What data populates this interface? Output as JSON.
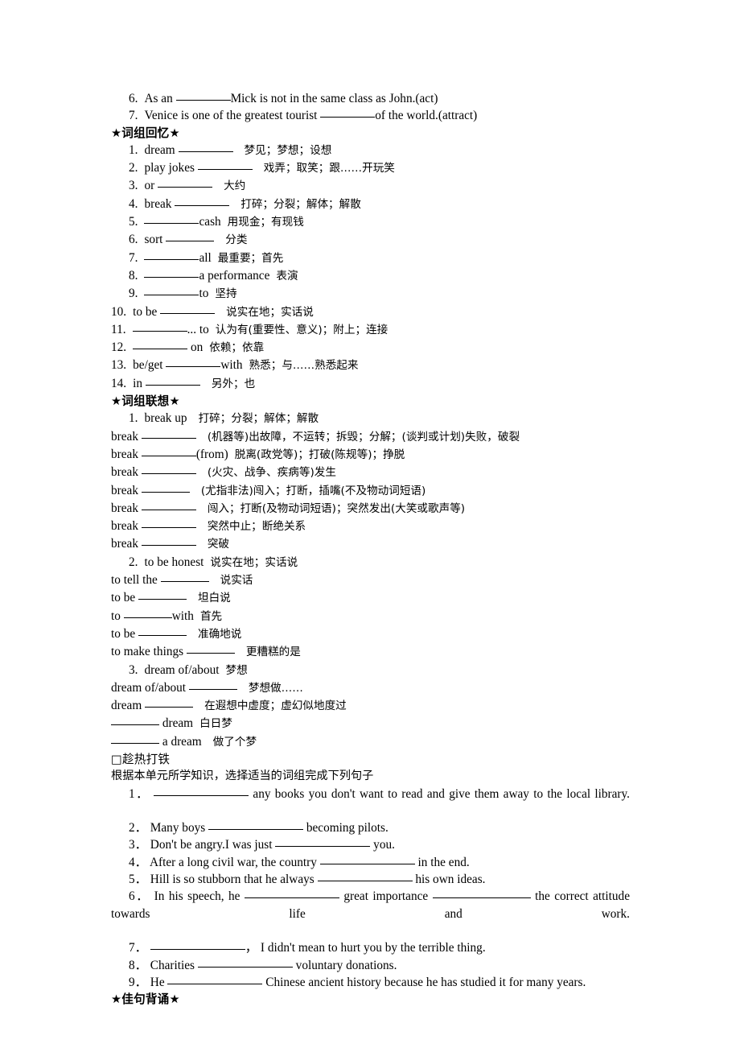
{
  "document": {
    "type": "english-workbook-worksheet",
    "language": "en-zh"
  },
  "word_form_items": [
    {
      "number": "6.",
      "before": "As an",
      "after": "Mick is not in the same class as John.(act)"
    },
    {
      "number": "7.",
      "before": "Venice is one of the greatest tourist",
      "after": "of the world.(attract)"
    }
  ],
  "phrase_recall": {
    "heading": "★词组回忆★",
    "items": [
      {
        "number": "1.",
        "before": "dream",
        "after": "",
        "gloss": "梦见；梦想；设想"
      },
      {
        "number": "2.",
        "before": "play jokes",
        "after": "",
        "gloss": "戏弄；取笑；跟……开玩笑"
      },
      {
        "number": "3.",
        "before": "or",
        "after": "",
        "gloss": "大约"
      },
      {
        "number": "4.",
        "before": "break",
        "after": "",
        "gloss": "打碎；分裂；解体；解散"
      },
      {
        "number": "5.",
        "before": "",
        "after": "cash",
        "gloss": "用现金；有现钱"
      },
      {
        "number": "6.",
        "before": "sort",
        "after": "",
        "gloss": "分类"
      },
      {
        "number": "7.",
        "before": "",
        "after": "all",
        "gloss": "最重要；首先"
      },
      {
        "number": "8.",
        "before": "",
        "after": "a performance",
        "gloss": "表演"
      },
      {
        "number": "9.",
        "before": "",
        "after": "to",
        "gloss": "坚持"
      },
      {
        "number": "10.",
        "before": "to be",
        "after": "",
        "gloss": "说实在地；实话说"
      },
      {
        "number": "11.",
        "before": "",
        "after": "... to",
        "gloss": "认为有(重要性、意义)；附上；连接"
      },
      {
        "number": "12.",
        "before": "",
        "after": "on",
        "gloss": "依赖；依靠"
      },
      {
        "number": "13.",
        "before": "be/get",
        "after": "with",
        "gloss": "熟悉；与……熟悉起来"
      },
      {
        "number": "14.",
        "before": "in",
        "after": "",
        "gloss": "另外；也"
      }
    ]
  },
  "phrase_association": {
    "heading": "★词组联想★",
    "groups": [
      {
        "number": "1.",
        "headword": "break up",
        "head_gloss": "打碎；分裂；解体；解散",
        "lines": [
          {
            "before": "break",
            "after": "",
            "gloss": "(机器等)出故障，不运转；拆毁；分解；(谈判或计划)失败，破裂"
          },
          {
            "before": "break",
            "after": "(from)",
            "gloss": "脱离(政党等)；打破(陈规等)；挣脱"
          },
          {
            "before": "break",
            "after": "",
            "gloss": "(火灾、战争、疾病等)发生"
          },
          {
            "before": "break",
            "after": "",
            "gloss": "(尤指非法)闯入；打断，插嘴(不及物动词短语)"
          },
          {
            "before": "break",
            "after": "",
            "gloss": "闯入；打断(及物动词短语)；突然发出(大笑或歌声等)"
          },
          {
            "before": "break",
            "after": "",
            "gloss": "突然中止；断绝关系"
          },
          {
            "before": "break",
            "after": "",
            "gloss": "突破"
          }
        ]
      },
      {
        "number": "2.",
        "headword": "to be honest",
        "head_gloss": "说实在地；实话说",
        "lines": [
          {
            "before": "to tell the",
            "after": "",
            "gloss": "说实话"
          },
          {
            "before": "to be",
            "after": "",
            "gloss": "坦白说"
          },
          {
            "before": "to",
            "after": "with",
            "gloss": "首先"
          },
          {
            "before": "to be",
            "after": "",
            "gloss": "准确地说"
          },
          {
            "before": "to make things",
            "after": "",
            "gloss": "更糟糕的是"
          }
        ]
      },
      {
        "number": "3.",
        "headword": "dream of/about",
        "head_gloss": "梦想",
        "lines": [
          {
            "before": "dream of/about",
            "after": "",
            "gloss": "梦想做……"
          },
          {
            "before": "dream",
            "after": "",
            "gloss": "在遐想中虚度；虚幻似地度过"
          },
          {
            "before": "",
            "after": "dream",
            "gloss": "白日梦"
          },
          {
            "before": "",
            "after": "a dream",
            "gloss": "做了个梦"
          }
        ]
      }
    ]
  },
  "strike_while_hot": {
    "heading": "□趁热打铁",
    "instruction": "根据本单元所学知识，选择适当的词组完成下列句子",
    "sentences": [
      {
        "number": "1．",
        "parts": [
          "",
          " any books you don't want to read and give them away to the local library."
        ]
      },
      {
        "number": "2．",
        "parts": [
          "Many boys ",
          " becoming pilots."
        ]
      },
      {
        "number": "3．",
        "parts": [
          "Don't be angry.I was just ",
          " you."
        ]
      },
      {
        "number": "4．",
        "parts": [
          "After a long civil war, the country ",
          " in the end."
        ]
      },
      {
        "number": "5．",
        "parts": [
          "Hill is so stubborn that he always ",
          " his own ideas."
        ]
      },
      {
        "number": "6．",
        "parts": [
          "In his speech, he ",
          " great importance ",
          " the correct attitude towards life and work."
        ]
      },
      {
        "number": "7．",
        "parts": [
          "",
          "，  I didn't mean to hurt you by the terrible thing."
        ]
      },
      {
        "number": "8．",
        "parts": [
          "Charities ",
          " voluntary donations."
        ]
      },
      {
        "number": "9．",
        "parts": [
          "He ",
          " Chinese ancient history because he has studied it for many years."
        ]
      }
    ]
  },
  "sentence_recitation": {
    "heading": "★佳句背诵★"
  }
}
